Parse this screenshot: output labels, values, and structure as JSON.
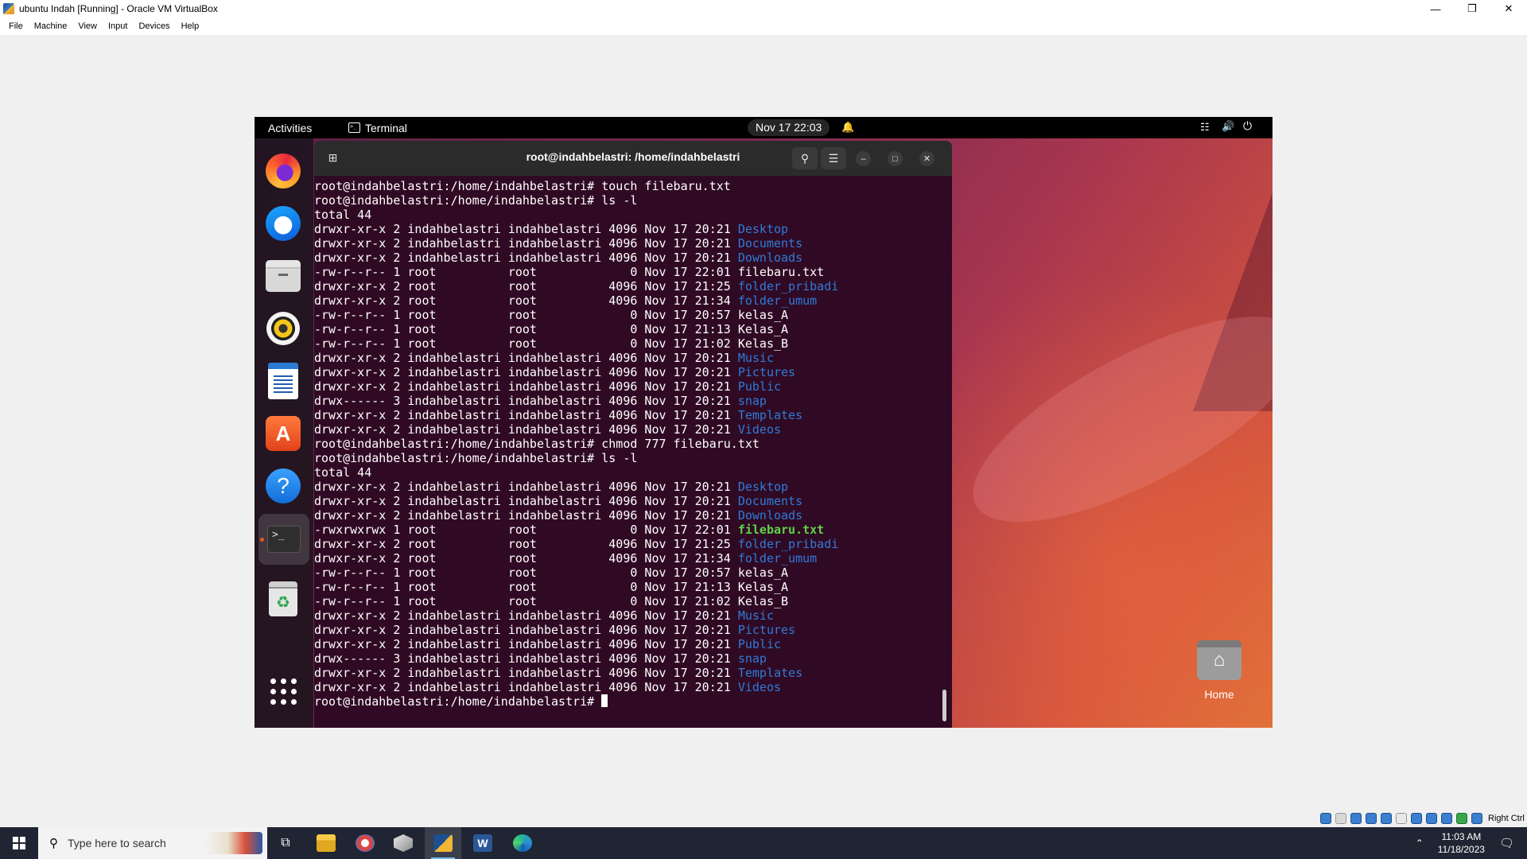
{
  "vbox": {
    "title": "ubuntu Indah [Running] - Oracle VM VirtualBox",
    "menu": [
      "File",
      "Machine",
      "View",
      "Input",
      "Devices",
      "Help"
    ],
    "host_key": "Right Ctrl"
  },
  "ubuntu": {
    "activities": "Activities",
    "app_name": "Terminal",
    "clock": "Nov 17  22:03",
    "dock_icons": [
      "firefox-icon",
      "thunderbird-icon",
      "files-icon",
      "rhythmbox-icon",
      "writer-icon",
      "app-center-icon",
      "help-icon",
      "terminal-icon",
      "trash-icon",
      "show-apps-icon"
    ],
    "desktop_home_label": "Home"
  },
  "terminal": {
    "title": "root@indahbelastri: /home/indahbelastri",
    "lines": [
      {
        "text": "root@indahbelastri:/home/indahbelastri# touch filebaru.txt",
        "name": ""
      },
      {
        "text": "root@indahbelastri:/home/indahbelastri# ls -l",
        "name": ""
      },
      {
        "text": "total 44",
        "name": ""
      },
      {
        "text": "drwxr-xr-x 2 indahbelastri indahbelastri 4096 Nov 17 20:21 ",
        "name": "Desktop",
        "kind": "dir"
      },
      {
        "text": "drwxr-xr-x 2 indahbelastri indahbelastri 4096 Nov 17 20:21 ",
        "name": "Documents",
        "kind": "dir"
      },
      {
        "text": "drwxr-xr-x 2 indahbelastri indahbelastri 4096 Nov 17 20:21 ",
        "name": "Downloads",
        "kind": "dir"
      },
      {
        "text": "-rw-r--r-- 1 root          root             0 Nov 17 22:01 ",
        "name": "filebaru.txt",
        "kind": "file"
      },
      {
        "text": "drwxr-xr-x 2 root          root          4096 Nov 17 21:25 ",
        "name": "folder_pribadi",
        "kind": "dir"
      },
      {
        "text": "drwxr-xr-x 2 root          root          4096 Nov 17 21:34 ",
        "name": "folder_umum",
        "kind": "dir"
      },
      {
        "text": "-rw-r--r-- 1 root          root             0 Nov 17 20:57 ",
        "name": "kelas_A",
        "kind": "file"
      },
      {
        "text": "-rw-r--r-- 1 root          root             0 Nov 17 21:13 ",
        "name": "Kelas_A",
        "kind": "file"
      },
      {
        "text": "-rw-r--r-- 1 root          root             0 Nov 17 21:02 ",
        "name": "Kelas_B",
        "kind": "file"
      },
      {
        "text": "drwxr-xr-x 2 indahbelastri indahbelastri 4096 Nov 17 20:21 ",
        "name": "Music",
        "kind": "dir"
      },
      {
        "text": "drwxr-xr-x 2 indahbelastri indahbelastri 4096 Nov 17 20:21 ",
        "name": "Pictures",
        "kind": "dir"
      },
      {
        "text": "drwxr-xr-x 2 indahbelastri indahbelastri 4096 Nov 17 20:21 ",
        "name": "Public",
        "kind": "dir"
      },
      {
        "text": "drwx------ 3 indahbelastri indahbelastri 4096 Nov 17 20:21 ",
        "name": "snap",
        "kind": "dir"
      },
      {
        "text": "drwxr-xr-x 2 indahbelastri indahbelastri 4096 Nov 17 20:21 ",
        "name": "Templates",
        "kind": "dir"
      },
      {
        "text": "drwxr-xr-x 2 indahbelastri indahbelastri 4096 Nov 17 20:21 ",
        "name": "Videos",
        "kind": "dir"
      },
      {
        "text": "root@indahbelastri:/home/indahbelastri# chmod 777 filebaru.txt",
        "name": ""
      },
      {
        "text": "root@indahbelastri:/home/indahbelastri# ls -l",
        "name": ""
      },
      {
        "text": "total 44",
        "name": ""
      },
      {
        "text": "drwxr-xr-x 2 indahbelastri indahbelastri 4096 Nov 17 20:21 ",
        "name": "Desktop",
        "kind": "dir"
      },
      {
        "text": "drwxr-xr-x 2 indahbelastri indahbelastri 4096 Nov 17 20:21 ",
        "name": "Documents",
        "kind": "dir"
      },
      {
        "text": "drwxr-xr-x 2 indahbelastri indahbelastri 4096 Nov 17 20:21 ",
        "name": "Downloads",
        "kind": "dir"
      },
      {
        "text": "-rwxrwxrwx 1 root          root             0 Nov 17 22:01 ",
        "name": "filebaru.txt",
        "kind": "exec"
      },
      {
        "text": "drwxr-xr-x 2 root          root          4096 Nov 17 21:25 ",
        "name": "folder_pribadi",
        "kind": "dir"
      },
      {
        "text": "drwxr-xr-x 2 root          root          4096 Nov 17 21:34 ",
        "name": "folder_umum",
        "kind": "dir"
      },
      {
        "text": "-rw-r--r-- 1 root          root             0 Nov 17 20:57 ",
        "name": "kelas_A",
        "kind": "file"
      },
      {
        "text": "-rw-r--r-- 1 root          root             0 Nov 17 21:13 ",
        "name": "Kelas_A",
        "kind": "file"
      },
      {
        "text": "-rw-r--r-- 1 root          root             0 Nov 17 21:02 ",
        "name": "Kelas_B",
        "kind": "file"
      },
      {
        "text": "drwxr-xr-x 2 indahbelastri indahbelastri 4096 Nov 17 20:21 ",
        "name": "Music",
        "kind": "dir"
      },
      {
        "text": "drwxr-xr-x 2 indahbelastri indahbelastri 4096 Nov 17 20:21 ",
        "name": "Pictures",
        "kind": "dir"
      },
      {
        "text": "drwxr-xr-x 2 indahbelastri indahbelastri 4096 Nov 17 20:21 ",
        "name": "Public",
        "kind": "dir"
      },
      {
        "text": "drwx------ 3 indahbelastri indahbelastri 4096 Nov 17 20:21 ",
        "name": "snap",
        "kind": "dir"
      },
      {
        "text": "drwxr-xr-x 2 indahbelastri indahbelastri 4096 Nov 17 20:21 ",
        "name": "Templates",
        "kind": "dir"
      },
      {
        "text": "drwxr-xr-x 2 indahbelastri indahbelastri 4096 Nov 17 20:21 ",
        "name": "Videos",
        "kind": "dir"
      }
    ],
    "prompt": "root@indahbelastri:/home/indahbelastri# ",
    "colors": {
      "background": "#300a24",
      "directory": "#2f7bd8",
      "executable": "#5fd14a",
      "text": "#ffffff"
    }
  },
  "windows": {
    "search_placeholder": "Type here to search",
    "time": "11:03 AM",
    "date": "11/18/2023",
    "taskbar_apps": [
      "task-view-icon",
      "file-explorer-icon",
      "app-icon",
      "app-icon",
      "virtualbox-icon",
      "word-icon",
      "edge-icon"
    ]
  }
}
